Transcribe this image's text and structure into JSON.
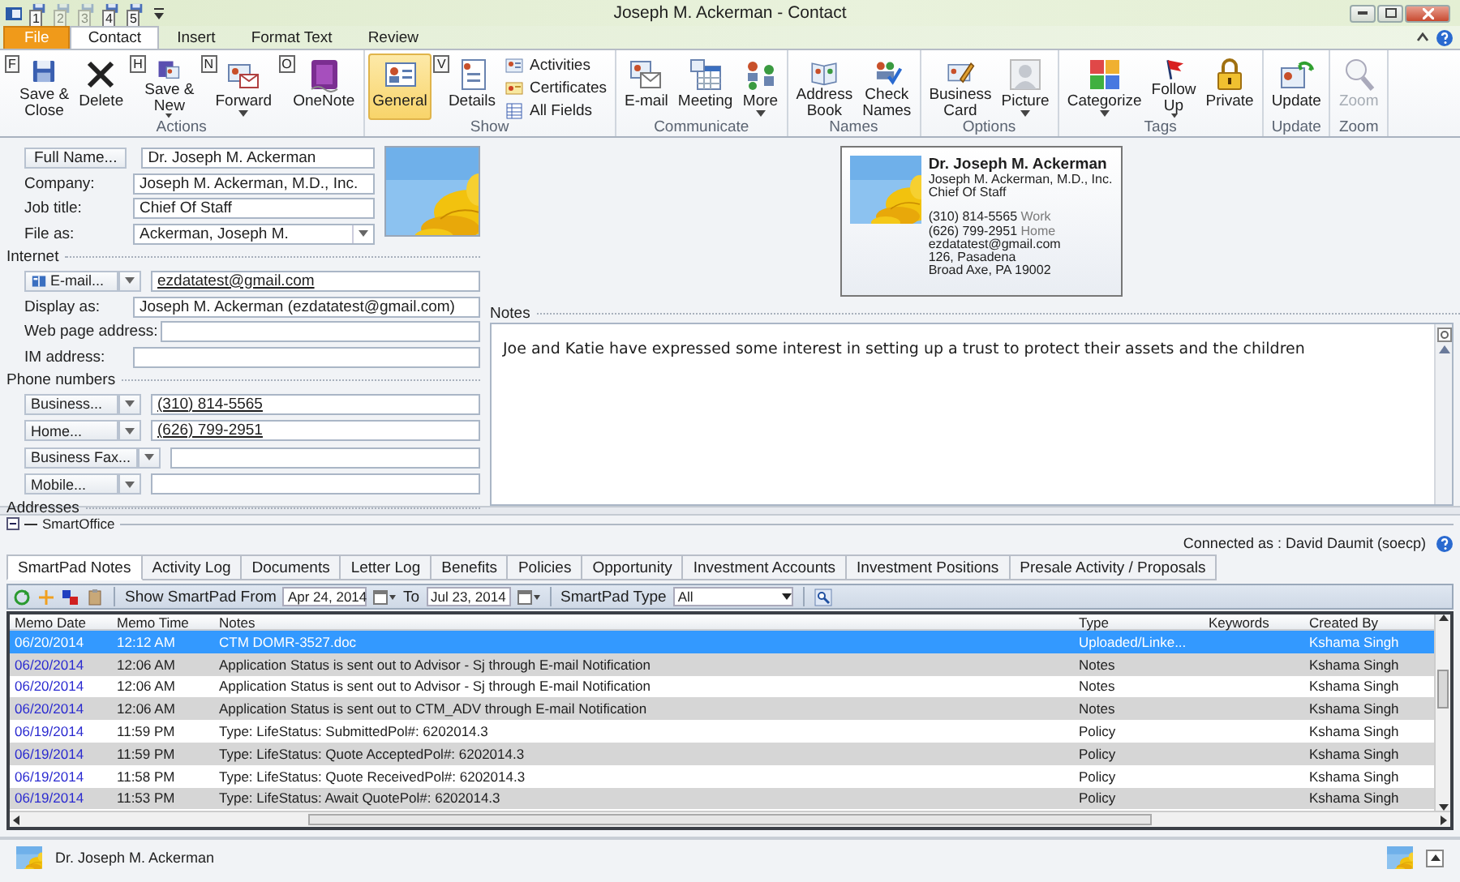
{
  "window": {
    "title": "Joseph M. Ackerman  -  Contact",
    "quick_access": [
      {
        "keytip": "1",
        "disabled": false
      },
      {
        "keytip": "2",
        "disabled": true
      },
      {
        "keytip": "3",
        "disabled": true
      },
      {
        "keytip": "4",
        "disabled": false
      },
      {
        "keytip": "5",
        "disabled": false
      }
    ]
  },
  "ribbon_tabs": [
    {
      "label": "File",
      "kind": "file",
      "selected": false
    },
    {
      "label": "Contact",
      "kind": "tab",
      "selected": true
    },
    {
      "label": "Insert",
      "kind": "tab",
      "selected": false
    },
    {
      "label": "Format Text",
      "kind": "tab",
      "selected": false
    },
    {
      "label": "Review",
      "kind": "tab",
      "selected": false
    }
  ],
  "ribbon": {
    "groups": [
      {
        "label": "Actions",
        "items": [
          {
            "label": "Save &\nClose",
            "keytip": "F",
            "dropdown": false,
            "disabled": false,
            "selected": false
          },
          {
            "label": "Delete",
            "dropdown": false,
            "disabled": false,
            "selected": false
          },
          {
            "label": "Save &\nNew",
            "keytip": "H",
            "dropdown": true,
            "disabled": false,
            "selected": false
          },
          {
            "label": "Forward",
            "keytip": "N",
            "dropdown": true,
            "disabled": false,
            "selected": false
          },
          {
            "label": "OneNote",
            "keytip": "O",
            "dropdown": false,
            "disabled": false,
            "selected": false
          }
        ]
      },
      {
        "label": "Show",
        "items": [
          {
            "label": "General",
            "dropdown": false,
            "disabled": false,
            "selected": true
          },
          {
            "label": "Details",
            "keytip": "V",
            "dropdown": false,
            "disabled": false,
            "selected": false
          }
        ],
        "small_items": [
          {
            "label": "Activities",
            "selected": false
          },
          {
            "label": "Certificates",
            "selected": false
          },
          {
            "label": "All Fields",
            "selected": false
          }
        ]
      },
      {
        "label": "Communicate",
        "items": [
          {
            "label": "E-mail",
            "dropdown": false,
            "disabled": false,
            "selected": false
          },
          {
            "label": "Meeting",
            "dropdown": false,
            "disabled": false,
            "selected": false
          },
          {
            "label": "More",
            "dropdown": true,
            "disabled": false,
            "selected": false
          }
        ]
      },
      {
        "label": "Names",
        "items": [
          {
            "label": "Address\nBook",
            "dropdown": false,
            "disabled": false,
            "selected": false
          },
          {
            "label": "Check\nNames",
            "dropdown": false,
            "disabled": false,
            "selected": false
          }
        ]
      },
      {
        "label": "Options",
        "items": [
          {
            "label": "Business\nCard",
            "dropdown": false,
            "disabled": false,
            "selected": false
          },
          {
            "label": "Picture",
            "dropdown": true,
            "disabled": false,
            "selected": false
          }
        ]
      },
      {
        "label": "Tags",
        "items": [
          {
            "label": "Categorize",
            "dropdown": true,
            "disabled": false,
            "selected": false
          },
          {
            "label": "Follow\nUp",
            "dropdown": true,
            "disabled": false,
            "selected": false
          },
          {
            "label": "Private",
            "dropdown": false,
            "disabled": false,
            "selected": false
          }
        ]
      },
      {
        "label": "Update",
        "items": [
          {
            "label": "Update",
            "dropdown": false,
            "disabled": false,
            "selected": false
          }
        ]
      },
      {
        "label": "Zoom",
        "items": [
          {
            "label": "Zoom",
            "dropdown": false,
            "disabled": true,
            "selected": false
          }
        ]
      }
    ]
  },
  "contact_form": {
    "header_rows": [
      {
        "kind": "button",
        "label": "Full Name...",
        "value": "Dr. Joseph M. Ackerman"
      },
      {
        "kind": "label",
        "label": "Company:",
        "value": "Joseph M. Ackerman, M.D., Inc."
      },
      {
        "kind": "label",
        "label": "Job title:",
        "value": "Chief Of Staff"
      },
      {
        "kind": "combo",
        "label": "File as:",
        "value": "Ackerman, Joseph M."
      }
    ],
    "rows": [
      {
        "kind": "section",
        "label": "Internet"
      },
      {
        "kind": "split",
        "label": "E-mail...",
        "value": "ezdatatest@gmail.com",
        "link": true,
        "has_icon": true
      },
      {
        "kind": "label",
        "label": "Display as:",
        "value": "Joseph M. Ackerman (ezdatatest@gmail.com)"
      },
      {
        "kind": "label",
        "label": "Web page address:"
      },
      {
        "kind": "label",
        "label": "IM address:"
      },
      {
        "kind": "section",
        "label": "Phone numbers"
      },
      {
        "kind": "split",
        "label": "Business...",
        "value": "(310) 814-5565",
        "link": true,
        "has_icon": false
      },
      {
        "kind": "split",
        "label": "Home...",
        "value": "(626) 799-2951",
        "link": true,
        "has_icon": false
      },
      {
        "kind": "split",
        "label": "Business Fax...",
        "has_icon": false
      },
      {
        "kind": "split",
        "label": "Mobile...",
        "has_icon": false
      },
      {
        "kind": "section",
        "label": "Addresses"
      }
    ]
  },
  "business_card": {
    "name": "Dr. Joseph M. Ackerman",
    "company": "Joseph M. Ackerman, M.D., Inc.",
    "job_title": "Chief Of Staff",
    "phones": [
      {
        "number": "(310) 814-5565",
        "type": "Work"
      },
      {
        "number": "(626) 799-2951",
        "type": "Home"
      }
    ],
    "email": "ezdatatest@gmail.com",
    "address_lines": [
      "126, Pasadena",
      "Broad Axe, PA  19002"
    ]
  },
  "notes": {
    "label": "Notes",
    "text": "Joe and Katie have expressed some interest in setting up a trust to protect their assets and the children"
  },
  "smartoffice": {
    "title": "SmartOffice",
    "connected": "Connected as : David Daumit (soecp)",
    "tabs": [
      {
        "label": "SmartPad Notes",
        "selected": true
      },
      {
        "label": "Activity Log",
        "selected": false
      },
      {
        "label": "Documents",
        "selected": false
      },
      {
        "label": "Letter Log",
        "selected": false
      },
      {
        "label": "Benefits",
        "selected": false
      },
      {
        "label": "Policies",
        "selected": false
      },
      {
        "label": "Opportunity",
        "selected": false
      },
      {
        "label": "Investment Accounts",
        "selected": false
      },
      {
        "label": "Investment Positions",
        "selected": false
      },
      {
        "label": "Presale Activity / Proposals",
        "selected": false
      }
    ],
    "toolbar": {
      "from_label": "Show SmartPad From",
      "from": "Apr 24, 2014",
      "to_label": "To",
      "to": "Jul 23, 2014",
      "type_label": "SmartPad Type",
      "type": "All"
    },
    "table": {
      "columns": [
        "Memo Date",
        "Memo Time",
        "Notes",
        "Type",
        "Keywords",
        "Created By"
      ],
      "rows": [
        {
          "selected": true,
          "cells": [
            "06/20/2014",
            "12:12 AM",
            "CTM DOMR-3527.doc",
            "Uploaded/Linke...",
            "",
            "Kshama Singh"
          ]
        },
        {
          "selected": false,
          "cells": [
            "06/20/2014",
            "12:06 AM",
            "Application Status is sent out to Advisor - Sj through E-mail Notification",
            "Notes",
            "",
            "Kshama Singh"
          ]
        },
        {
          "selected": false,
          "cells": [
            "06/20/2014",
            "12:06 AM",
            "Application Status is sent out to Advisor - Sj through E-mail Notification",
            "Notes",
            "",
            "Kshama Singh"
          ]
        },
        {
          "selected": false,
          "cells": [
            "06/20/2014",
            "12:06 AM",
            "Application Status is sent out to CTM_ADV through E-mail Notification",
            "Notes",
            "",
            "Kshama Singh"
          ]
        },
        {
          "selected": false,
          "cells": [
            "06/19/2014",
            "11:59 PM",
            "Type: LifeStatus: SubmittedPol#: 6202014.3",
            "Policy",
            "",
            "Kshama Singh"
          ]
        },
        {
          "selected": false,
          "cells": [
            "06/19/2014",
            "11:59 PM",
            "Type: LifeStatus: Quote AcceptedPol#: 6202014.3",
            "Policy",
            "",
            "Kshama Singh"
          ]
        },
        {
          "selected": false,
          "cells": [
            "06/19/2014",
            "11:58 PM",
            "Type: LifeStatus: Quote ReceivedPol#: 6202014.3",
            "Policy",
            "",
            "Kshama Singh"
          ]
        },
        {
          "selected": false,
          "cells": [
            "06/19/2014",
            "11:53 PM",
            "Type: LifeStatus: Await QuotePol#: 6202014.3",
            "Policy",
            "",
            "Kshama Singh"
          ]
        }
      ]
    }
  },
  "footer": {
    "name": "Dr. Joseph M. Ackerman"
  }
}
